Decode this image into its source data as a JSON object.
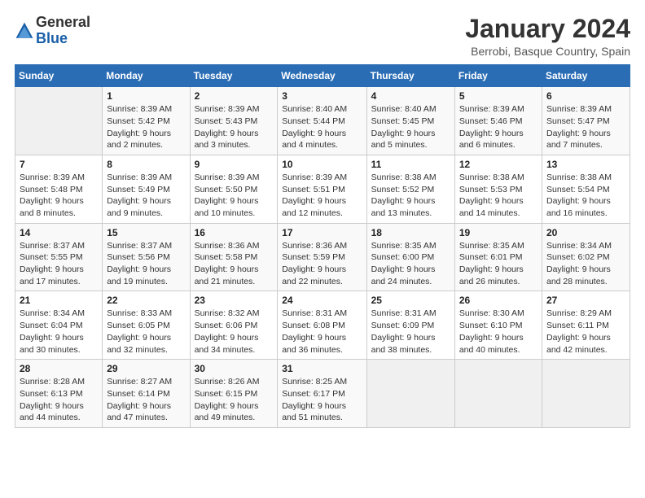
{
  "logo": {
    "general": "General",
    "blue": "Blue"
  },
  "header": {
    "month": "January 2024",
    "location": "Berrobi, Basque Country, Spain"
  },
  "weekdays": [
    "Sunday",
    "Monday",
    "Tuesday",
    "Wednesday",
    "Thursday",
    "Friday",
    "Saturday"
  ],
  "weeks": [
    [
      {
        "day": "",
        "info": ""
      },
      {
        "day": "1",
        "info": "Sunrise: 8:39 AM\nSunset: 5:42 PM\nDaylight: 9 hours\nand 2 minutes."
      },
      {
        "day": "2",
        "info": "Sunrise: 8:39 AM\nSunset: 5:43 PM\nDaylight: 9 hours\nand 3 minutes."
      },
      {
        "day": "3",
        "info": "Sunrise: 8:40 AM\nSunset: 5:44 PM\nDaylight: 9 hours\nand 4 minutes."
      },
      {
        "day": "4",
        "info": "Sunrise: 8:40 AM\nSunset: 5:45 PM\nDaylight: 9 hours\nand 5 minutes."
      },
      {
        "day": "5",
        "info": "Sunrise: 8:39 AM\nSunset: 5:46 PM\nDaylight: 9 hours\nand 6 minutes."
      },
      {
        "day": "6",
        "info": "Sunrise: 8:39 AM\nSunset: 5:47 PM\nDaylight: 9 hours\nand 7 minutes."
      }
    ],
    [
      {
        "day": "7",
        "info": "Sunrise: 8:39 AM\nSunset: 5:48 PM\nDaylight: 9 hours\nand 8 minutes."
      },
      {
        "day": "8",
        "info": "Sunrise: 8:39 AM\nSunset: 5:49 PM\nDaylight: 9 hours\nand 9 minutes."
      },
      {
        "day": "9",
        "info": "Sunrise: 8:39 AM\nSunset: 5:50 PM\nDaylight: 9 hours\nand 10 minutes."
      },
      {
        "day": "10",
        "info": "Sunrise: 8:39 AM\nSunset: 5:51 PM\nDaylight: 9 hours\nand 12 minutes."
      },
      {
        "day": "11",
        "info": "Sunrise: 8:38 AM\nSunset: 5:52 PM\nDaylight: 9 hours\nand 13 minutes."
      },
      {
        "day": "12",
        "info": "Sunrise: 8:38 AM\nSunset: 5:53 PM\nDaylight: 9 hours\nand 14 minutes."
      },
      {
        "day": "13",
        "info": "Sunrise: 8:38 AM\nSunset: 5:54 PM\nDaylight: 9 hours\nand 16 minutes."
      }
    ],
    [
      {
        "day": "14",
        "info": "Sunrise: 8:37 AM\nSunset: 5:55 PM\nDaylight: 9 hours\nand 17 minutes."
      },
      {
        "day": "15",
        "info": "Sunrise: 8:37 AM\nSunset: 5:56 PM\nDaylight: 9 hours\nand 19 minutes."
      },
      {
        "day": "16",
        "info": "Sunrise: 8:36 AM\nSunset: 5:58 PM\nDaylight: 9 hours\nand 21 minutes."
      },
      {
        "day": "17",
        "info": "Sunrise: 8:36 AM\nSunset: 5:59 PM\nDaylight: 9 hours\nand 22 minutes."
      },
      {
        "day": "18",
        "info": "Sunrise: 8:35 AM\nSunset: 6:00 PM\nDaylight: 9 hours\nand 24 minutes."
      },
      {
        "day": "19",
        "info": "Sunrise: 8:35 AM\nSunset: 6:01 PM\nDaylight: 9 hours\nand 26 minutes."
      },
      {
        "day": "20",
        "info": "Sunrise: 8:34 AM\nSunset: 6:02 PM\nDaylight: 9 hours\nand 28 minutes."
      }
    ],
    [
      {
        "day": "21",
        "info": "Sunrise: 8:34 AM\nSunset: 6:04 PM\nDaylight: 9 hours\nand 30 minutes."
      },
      {
        "day": "22",
        "info": "Sunrise: 8:33 AM\nSunset: 6:05 PM\nDaylight: 9 hours\nand 32 minutes."
      },
      {
        "day": "23",
        "info": "Sunrise: 8:32 AM\nSunset: 6:06 PM\nDaylight: 9 hours\nand 34 minutes."
      },
      {
        "day": "24",
        "info": "Sunrise: 8:31 AM\nSunset: 6:08 PM\nDaylight: 9 hours\nand 36 minutes."
      },
      {
        "day": "25",
        "info": "Sunrise: 8:31 AM\nSunset: 6:09 PM\nDaylight: 9 hours\nand 38 minutes."
      },
      {
        "day": "26",
        "info": "Sunrise: 8:30 AM\nSunset: 6:10 PM\nDaylight: 9 hours\nand 40 minutes."
      },
      {
        "day": "27",
        "info": "Sunrise: 8:29 AM\nSunset: 6:11 PM\nDaylight: 9 hours\nand 42 minutes."
      }
    ],
    [
      {
        "day": "28",
        "info": "Sunrise: 8:28 AM\nSunset: 6:13 PM\nDaylight: 9 hours\nand 44 minutes."
      },
      {
        "day": "29",
        "info": "Sunrise: 8:27 AM\nSunset: 6:14 PM\nDaylight: 9 hours\nand 47 minutes."
      },
      {
        "day": "30",
        "info": "Sunrise: 8:26 AM\nSunset: 6:15 PM\nDaylight: 9 hours\nand 49 minutes."
      },
      {
        "day": "31",
        "info": "Sunrise: 8:25 AM\nSunset: 6:17 PM\nDaylight: 9 hours\nand 51 minutes."
      },
      {
        "day": "",
        "info": ""
      },
      {
        "day": "",
        "info": ""
      },
      {
        "day": "",
        "info": ""
      }
    ]
  ]
}
